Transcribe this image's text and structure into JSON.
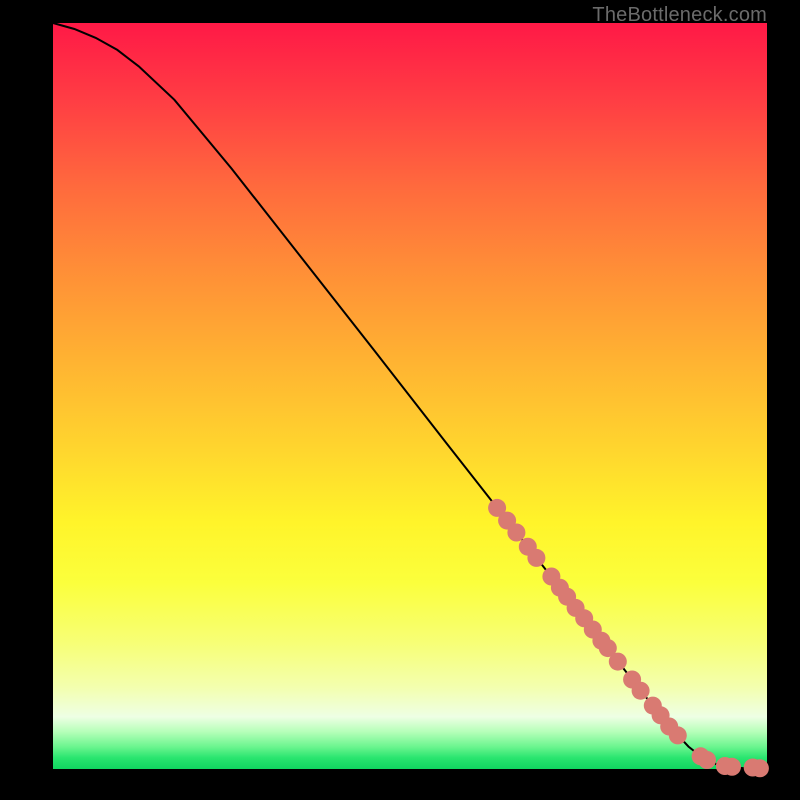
{
  "watermark": "TheBottleneck.com",
  "colors": {
    "marker": "#d97a72",
    "line": "#000000",
    "frame": "#000000"
  },
  "chart_data": {
    "type": "line",
    "title": "",
    "xlabel": "",
    "ylabel": "",
    "xlim": [
      0,
      100
    ],
    "ylim": [
      0,
      100
    ],
    "grid": false,
    "series": [
      {
        "name": "curve",
        "x": [
          0,
          3,
          6,
          9,
          12,
          17,
          25,
          35,
          45,
          55,
          65,
          72,
          78,
          82,
          86,
          89,
          91,
          93,
          95,
          97,
          100
        ],
        "y": [
          100,
          99.2,
          98,
          96.4,
          94.2,
          89.7,
          80.5,
          68.3,
          56.1,
          43.8,
          31.6,
          23.1,
          15.8,
          10.9,
          6.1,
          3.0,
          1.5,
          0.6,
          0.2,
          0.1,
          0.1
        ]
      }
    ],
    "markers": [
      {
        "x": 62.2,
        "y": 35.0
      },
      {
        "x": 63.6,
        "y": 33.3
      },
      {
        "x": 64.9,
        "y": 31.7
      },
      {
        "x": 66.5,
        "y": 29.8
      },
      {
        "x": 67.7,
        "y": 28.3
      },
      {
        "x": 69.8,
        "y": 25.8
      },
      {
        "x": 71.0,
        "y": 24.3
      },
      {
        "x": 72.0,
        "y": 23.1
      },
      {
        "x": 73.2,
        "y": 21.6
      },
      {
        "x": 74.4,
        "y": 20.2
      },
      {
        "x": 75.6,
        "y": 18.7
      },
      {
        "x": 76.8,
        "y": 17.2
      },
      {
        "x": 77.7,
        "y": 16.2
      },
      {
        "x": 79.1,
        "y": 14.4
      },
      {
        "x": 81.1,
        "y": 12.0
      },
      {
        "x": 82.3,
        "y": 10.5
      },
      {
        "x": 84.0,
        "y": 8.5
      },
      {
        "x": 85.1,
        "y": 7.2
      },
      {
        "x": 86.3,
        "y": 5.7
      },
      {
        "x": 87.5,
        "y": 4.5
      },
      {
        "x": 90.7,
        "y": 1.7
      },
      {
        "x": 91.6,
        "y": 1.2
      },
      {
        "x": 94.1,
        "y": 0.4
      },
      {
        "x": 95.1,
        "y": 0.3
      },
      {
        "x": 98.0,
        "y": 0.2
      },
      {
        "x": 99.0,
        "y": 0.1
      }
    ]
  }
}
